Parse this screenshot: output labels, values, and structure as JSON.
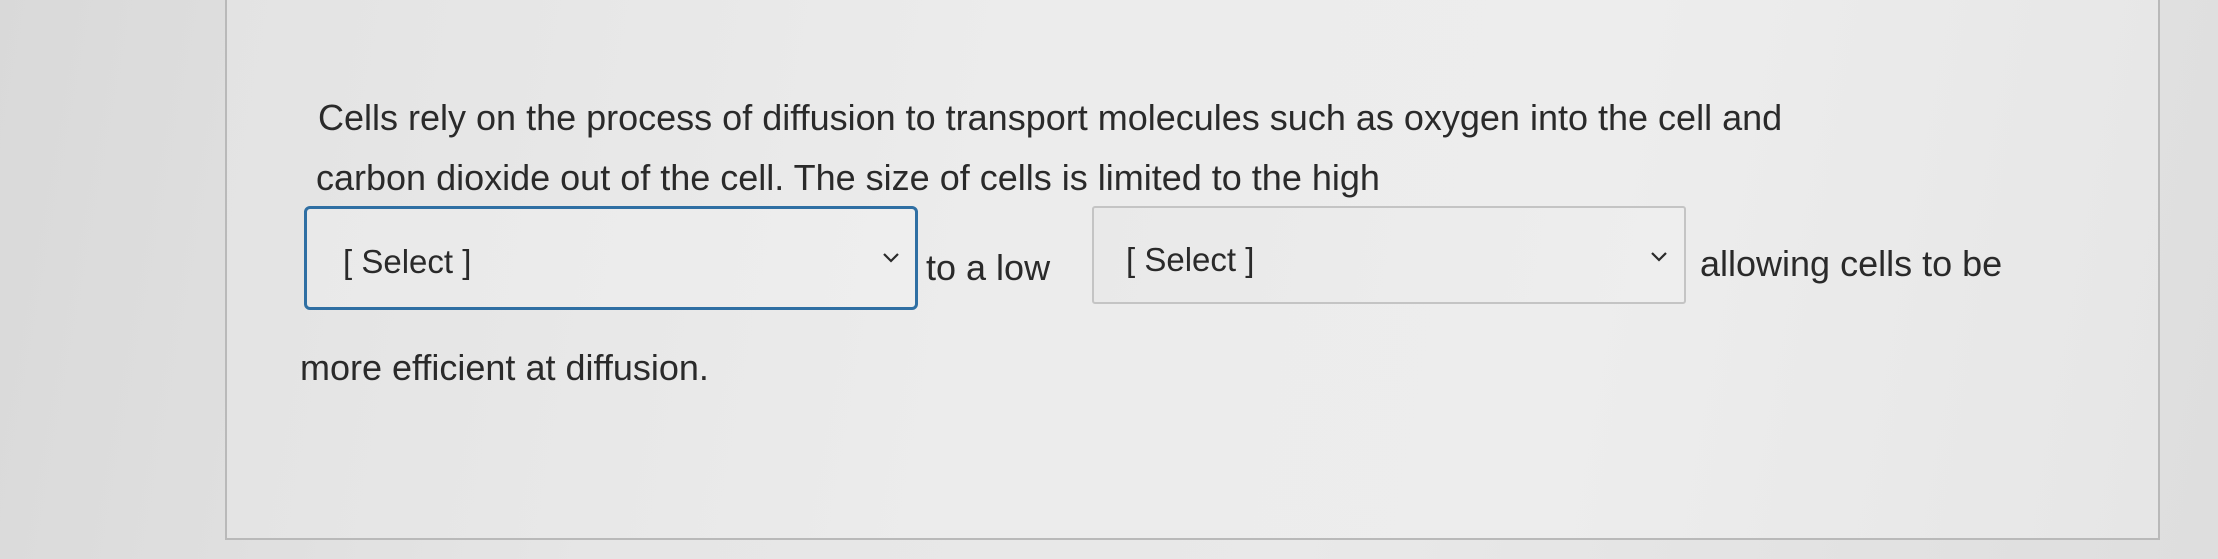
{
  "question": {
    "line1": "Cells rely on the process of diffusion to transport molecules such as oxygen into the cell and",
    "line2": "carbon dioxide out of the cell. The size of cells is limited to the high",
    "between_selects": "to a low",
    "after_select2": "allowing cells to be",
    "line4": "more efficient at diffusion."
  },
  "dropdowns": [
    {
      "selected": "[ Select ]",
      "icon": "chevron-down-icon"
    },
    {
      "selected": "[ Select ]",
      "icon": "chevron-down-icon"
    }
  ],
  "colors": {
    "focus_border": "#2f6fa3",
    "text": "#2a2a2a",
    "box_border": "#b9b9b9"
  }
}
